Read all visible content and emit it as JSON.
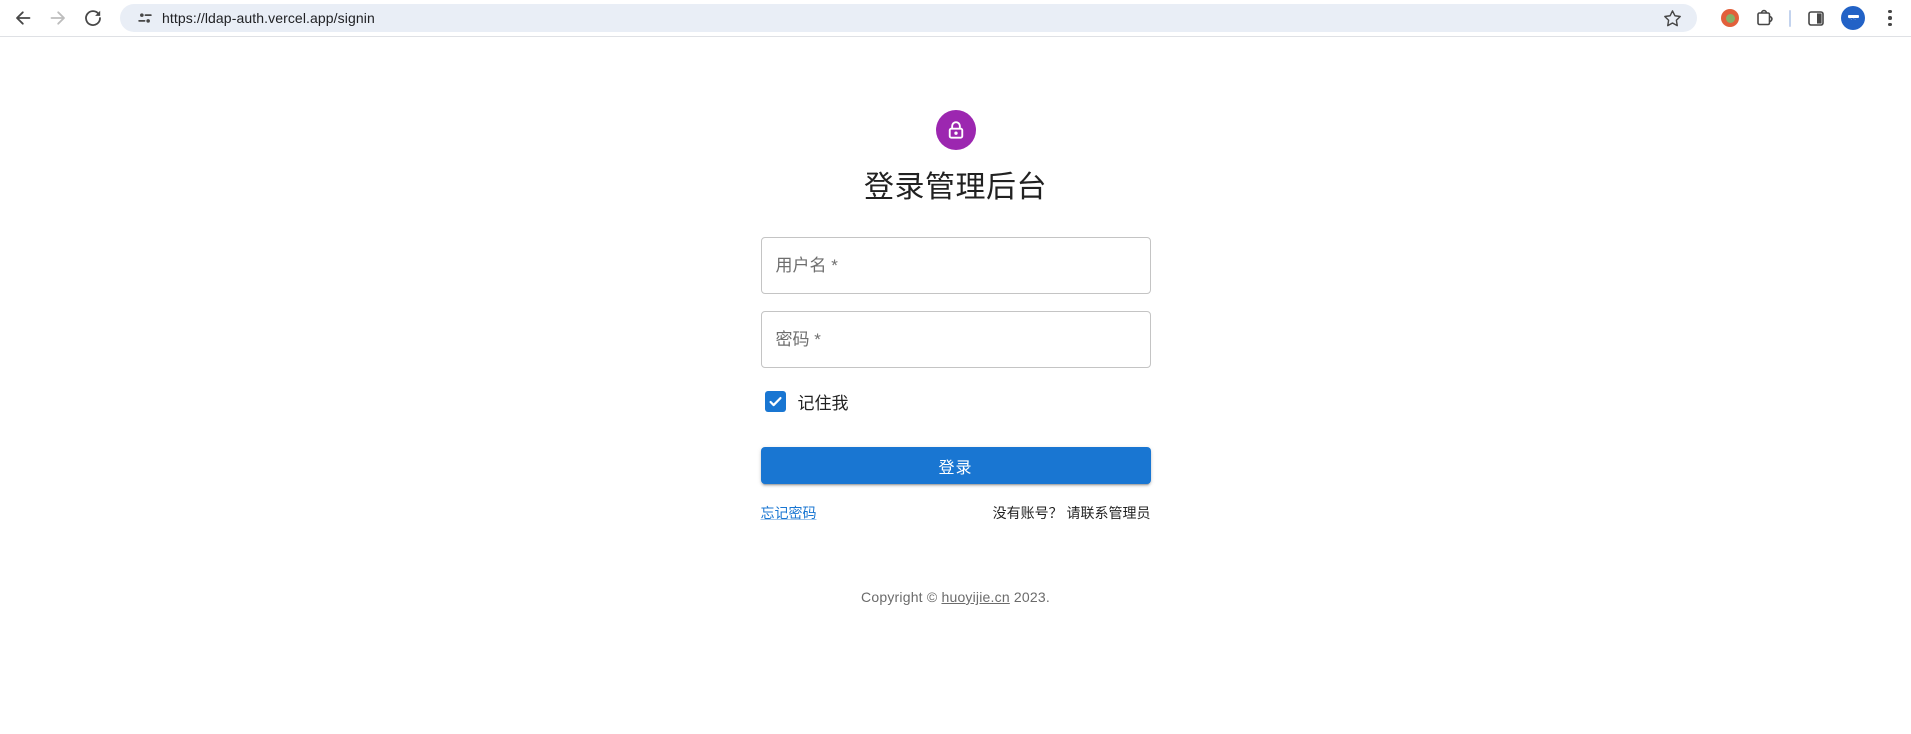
{
  "browser": {
    "url": "https://ldap-auth.vercel.app/signin",
    "icons": {
      "back": "back-arrow",
      "forward": "forward-arrow",
      "reload": "reload",
      "site_settings": "tune",
      "bookmark": "star-outline",
      "extension_badge": "orange-green-dot",
      "extensions": "puzzle",
      "side_panel": "side-panel",
      "profile": "blue-avatar",
      "menu": "three-dot-kebab"
    }
  },
  "signin": {
    "title": "登录管理后台",
    "username_label": "用户名 *",
    "username_value": "",
    "password_label": "密码 *",
    "password_value": "",
    "remember_label": "记住我",
    "remember_checked": true,
    "submit_label": "登录",
    "forgot_link": "忘记密码",
    "no_account_text": "没有账号？ 请联系管理员"
  },
  "footer": {
    "prefix": "Copyright © ",
    "link_text": "huoyijie.cn",
    "suffix": " 2023."
  },
  "colors": {
    "primary": "#1976d2",
    "secondary_avatar": "#9c27b0",
    "omnibox_bg": "#e9eef6",
    "toolbar_icon": "#474747"
  }
}
